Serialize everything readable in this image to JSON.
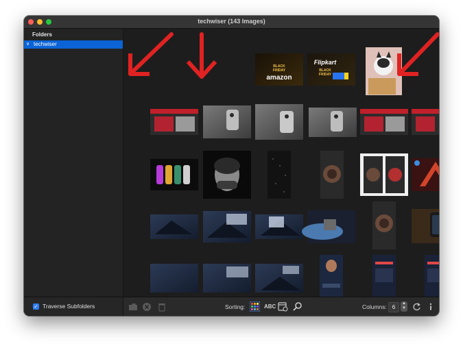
{
  "window": {
    "title": "techwiser (143 Images)"
  },
  "sidebar": {
    "header": "Folders",
    "items": [
      {
        "label": "techwiser",
        "expanded": true,
        "selected": true
      }
    ]
  },
  "bottom": {
    "traverse_label": "Traverse Subfolders",
    "traverse_checked": true,
    "sorting_label": "Sorting:",
    "abc_label": "ABC",
    "columns_label": "Columns:",
    "columns_value": "6"
  },
  "grid": {
    "row1": [
      {
        "type": "arrow"
      },
      {
        "type": "arrow"
      },
      {
        "type": "amazon",
        "brand": "amazon",
        "tag1": "BLACK",
        "tag2": "FRIDAY"
      },
      {
        "type": "flipkart",
        "brand": "Flipkart",
        "tag1": "BLACK",
        "tag2": "FRIDAY"
      },
      {
        "type": "cat"
      },
      {
        "type": "arrow"
      }
    ]
  },
  "colors": {
    "accent": "#0b63d6",
    "arrow": "#e02222",
    "close": "#ff5f57",
    "minimize": "#febc2e",
    "zoom": "#28c840"
  }
}
